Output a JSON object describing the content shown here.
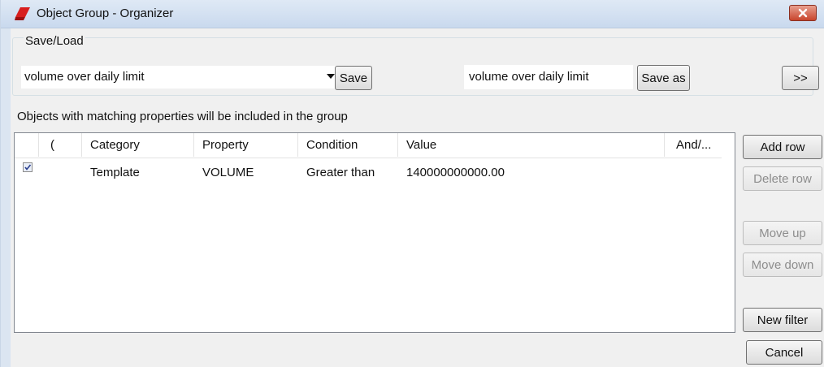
{
  "window": {
    "title": "Object Group - Organizer"
  },
  "save_load": {
    "legend": "Save/Load",
    "combo_value": "volume over daily limit",
    "save_label": "Save",
    "save_as_value": "volume over daily limit",
    "save_as_label": "Save as",
    "expand_label": ">>"
  },
  "info_text": "Objects with matching properties will be included in the group",
  "grid": {
    "columns": [
      "(",
      "Category",
      "Property",
      "Condition",
      "Value",
      "And/..."
    ],
    "rows": [
      {
        "checked": true,
        "paren": "",
        "category": "Template",
        "property": "VOLUME",
        "condition": "Greater than",
        "value": "140000000000.00",
        "and_or": ""
      }
    ]
  },
  "buttons": {
    "add_row": "Add row",
    "delete_row": "Delete row",
    "move_up": "Move up",
    "move_down": "Move down",
    "new_filter": "New filter",
    "cancel": "Cancel"
  },
  "colors": {
    "close_button": "#c8442c",
    "titlebar": "#c9d9ee",
    "app_icon": "#d81e1e"
  }
}
